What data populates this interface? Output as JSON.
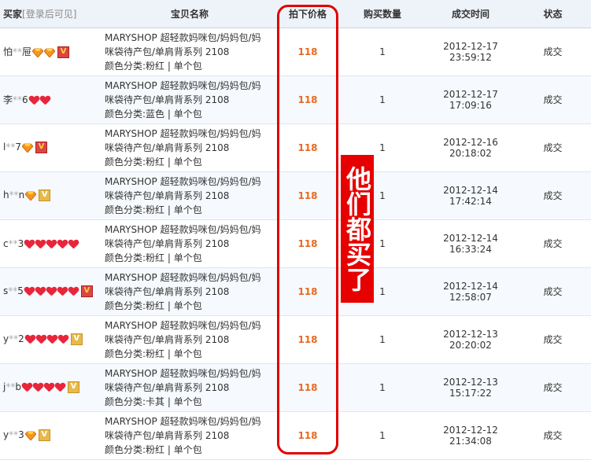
{
  "header": {
    "buyer": "买家",
    "buyer_hint": "[登录后可见]",
    "item": "宝贝名称",
    "price": "拍下价格",
    "qty": "购买数量",
    "time": "成交时间",
    "status": "状态"
  },
  "rows": [
    {
      "name_first": "怕",
      "name_mask": "**",
      "name_last": "屉",
      "badges": [
        "diamond",
        "diamond",
        "crown"
      ],
      "item": [
        "MARYSHOP 超轻款妈咪包/妈妈包/妈",
        "咪袋待产包/单肩背系列 2108",
        "颜色分类:粉红 | 单个包"
      ],
      "price": "118",
      "qty": "1",
      "time": "2012-12-17 23:59:12",
      "status": "成交"
    },
    {
      "name_first": "李",
      "name_mask": "**",
      "name_last": "6",
      "badges": [
        "heart",
        "heart"
      ],
      "item": [
        "MARYSHOP 超轻款妈咪包/妈妈包/妈",
        "咪袋待产包/单肩背系列 2108",
        "颜色分类:蓝色 | 单个包"
      ],
      "price": "118",
      "qty": "1",
      "time": "2012-12-17 17:09:16",
      "status": "成交"
    },
    {
      "name_first": "l",
      "name_mask": "**",
      "name_last": "7",
      "badges": [
        "diamond",
        "crown"
      ],
      "item": [
        "MARYSHOP 超轻款妈咪包/妈妈包/妈",
        "咪袋待产包/单肩背系列 2108",
        "颜色分类:粉红 | 单个包"
      ],
      "price": "118",
      "qty": "1",
      "time": "2012-12-16 20:18:02",
      "status": "成交"
    },
    {
      "name_first": "h",
      "name_mask": "**",
      "name_last": "n",
      "badges": [
        "diamond",
        "crown-gold"
      ],
      "item": [
        "MARYSHOP 超轻款妈咪包/妈妈包/妈",
        "咪袋待产包/单肩背系列 2108",
        "颜色分类:粉红 | 单个包"
      ],
      "price": "118",
      "qty": "1",
      "time": "2012-12-14 17:42:14",
      "status": "成交"
    },
    {
      "name_first": "c",
      "name_mask": "**",
      "name_last": "3",
      "badges": [
        "heart",
        "heart",
        "heart",
        "heart",
        "heart"
      ],
      "item": [
        "MARYSHOP 超轻款妈咪包/妈妈包/妈",
        "咪袋待产包/单肩背系列 2108",
        "颜色分类:粉红 | 单个包"
      ],
      "price": "118",
      "qty": "1",
      "time": "2012-12-14 16:33:24",
      "status": "成交"
    },
    {
      "name_first": "s",
      "name_mask": "**",
      "name_last": "5",
      "badges": [
        "heart",
        "heart",
        "heart",
        "heart",
        "heart",
        "crown"
      ],
      "item": [
        "MARYSHOP 超轻款妈咪包/妈妈包/妈",
        "咪袋待产包/单肩背系列 2108",
        "颜色分类:粉红 | 单个包"
      ],
      "price": "118",
      "qty": "1",
      "time": "2012-12-14 12:58:07",
      "status": "成交"
    },
    {
      "name_first": "y",
      "name_mask": "**",
      "name_last": "2",
      "badges": [
        "heart",
        "heart",
        "heart",
        "heart",
        "crown-gold"
      ],
      "item": [
        "MARYSHOP 超轻款妈咪包/妈妈包/妈",
        "咪袋待产包/单肩背系列 2108",
        "颜色分类:粉红 | 单个包"
      ],
      "price": "118",
      "qty": "1",
      "time": "2012-12-13 20:20:02",
      "status": "成交"
    },
    {
      "name_first": "j",
      "name_mask": "**",
      "name_last": "b",
      "badges": [
        "heart",
        "heart",
        "heart",
        "heart",
        "crown-gold"
      ],
      "item": [
        "MARYSHOP 超轻款妈咪包/妈妈包/妈",
        "咪袋待产包/单肩背系列 2108",
        "颜色分类:卡其 | 单个包"
      ],
      "price": "118",
      "qty": "1",
      "time": "2012-12-13 15:17:22",
      "status": "成交"
    },
    {
      "name_first": "y",
      "name_mask": "**",
      "name_last": "3",
      "badges": [
        "diamond",
        "crown-gold"
      ],
      "item": [
        "MARYSHOP 超轻款妈咪包/妈妈包/妈",
        "咪袋待产包/单肩背系列 2108",
        "颜色分类:粉红 | 单个包"
      ],
      "price": "118",
      "qty": "1",
      "time": "2012-12-12 21:34:08",
      "status": "成交"
    }
  ],
  "overlay_text": "他们都买了",
  "colors": {
    "price": "#e86a1f",
    "overlay": "#e60000",
    "header_bg": "#eef3fa"
  }
}
